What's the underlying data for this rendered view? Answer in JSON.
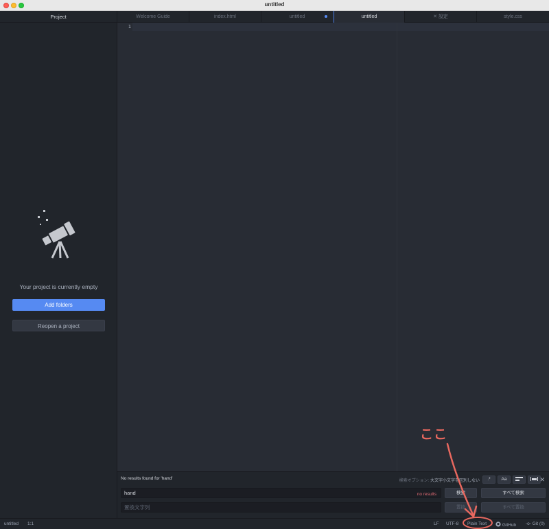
{
  "window": {
    "title": "untitled"
  },
  "sidebar": {
    "header": "Project",
    "empty_message": "Your project is currently empty",
    "add_folders_label": "Add folders",
    "reopen_label": "Reopen a project",
    "empty_icon": "telescope-icon"
  },
  "tabs": [
    {
      "label": "Welcome Guide",
      "active": false
    },
    {
      "label": "index.html",
      "active": false
    },
    {
      "label": "untitled",
      "active": false,
      "modified": true
    },
    {
      "label": "untitled",
      "active": true
    },
    {
      "label": "設定",
      "active": false,
      "icon": "tools-icon"
    },
    {
      "label": "style.css",
      "active": false
    }
  ],
  "editor": {
    "line_numbers": [
      "1"
    ]
  },
  "find": {
    "description": "No results found for 'hand'",
    "options_label": "検索オプション:",
    "options_value": "大文字小文字を区別しない",
    "option_buttons": [
      {
        "label": ".*",
        "icon": "regex-icon"
      },
      {
        "label": "Aa",
        "icon": "case-sensitive-icon"
      },
      {
        "label": "",
        "icon": "in-selection-icon"
      },
      {
        "label": "",
        "icon": "whole-word-icon"
      }
    ],
    "find_value": "hand",
    "find_status": "no results",
    "replace_placeholder": "置換文字列",
    "find_button": "検索",
    "find_all_button": "すべて検索",
    "replace_button": "置換",
    "replace_all_button": "すべて置換"
  },
  "statusbar": {
    "file": "untitled",
    "cursor": "1:1",
    "line_ending": "LF",
    "encoding": "UTF-8",
    "grammar": "Plain Text",
    "github": "GitHub",
    "git": "Git (0)"
  },
  "annotation": {
    "text": "ここ",
    "color": "#e8685f"
  }
}
